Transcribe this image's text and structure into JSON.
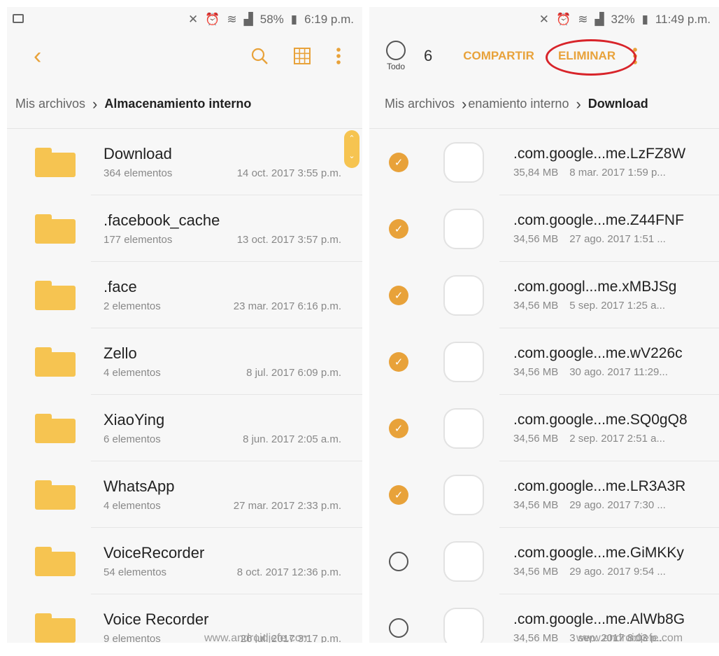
{
  "left": {
    "status": {
      "battery": "58%",
      "time": "6:19 p.m."
    },
    "breadcrumb": {
      "root": "Mis archivos",
      "current": "Almacenamiento interno"
    },
    "folders": [
      {
        "name": "Download",
        "count": "364 elementos",
        "date": "14 oct. 2017 3:55 p.m."
      },
      {
        "name": ".facebook_cache",
        "count": "177 elementos",
        "date": "13 oct. 2017 3:57 p.m."
      },
      {
        "name": ".face",
        "count": "2 elementos",
        "date": "23 mar. 2017 6:16 p.m."
      },
      {
        "name": "Zello",
        "count": "4 elementos",
        "date": "8 jul. 2017 6:09 p.m."
      },
      {
        "name": "XiaoYing",
        "count": "6 elementos",
        "date": "8 jun. 2017 2:05 a.m."
      },
      {
        "name": "WhatsApp",
        "count": "4 elementos",
        "date": "27 mar. 2017 2:33 p.m."
      },
      {
        "name": "VoiceRecorder",
        "count": "54 elementos",
        "date": "8 oct. 2017 12:36 p.m."
      },
      {
        "name": "Voice Recorder",
        "count": "9 elementos",
        "date": "26 jul. 2017 3:17 p.m."
      }
    ],
    "watermark": "www.androidjefe.com"
  },
  "right": {
    "status": {
      "battery": "32%",
      "time": "11:49 p.m."
    },
    "select_all_label": "Todo",
    "selected_count": "6",
    "share_label": "COMPARTIR",
    "delete_label": "ELIMINAR",
    "breadcrumb": {
      "root": "Mis archivos",
      "middle": "enamiento interno",
      "current": "Download"
    },
    "files": [
      {
        "name": ".com.google...me.LzFZ8W",
        "size": "35,84 MB",
        "date": "8 mar. 2017 1:59 p...",
        "checked": true
      },
      {
        "name": ".com.google...me.Z44FNF",
        "size": "34,56 MB",
        "date": "27 ago. 2017 1:51 ...",
        "checked": true
      },
      {
        "name": ".com.googl...me.xMBJSg",
        "size": "34,56 MB",
        "date": "5 sep. 2017 1:25 a...",
        "checked": true
      },
      {
        "name": ".com.google...me.wV226c",
        "size": "34,56 MB",
        "date": "30 ago. 2017 11:29...",
        "checked": true
      },
      {
        "name": ".com.google...me.SQ0gQ8",
        "size": "34,56 MB",
        "date": "2 sep. 2017 2:51 a...",
        "checked": true
      },
      {
        "name": ".com.google...me.LR3A3R",
        "size": "34,56 MB",
        "date": "29 ago. 2017 7:30 ...",
        "checked": true
      },
      {
        "name": ".com.google...me.GiMKKy",
        "size": "34,56 MB",
        "date": "29 ago. 2017 9:54 ...",
        "checked": false
      },
      {
        "name": ".com.google...me.AlWb8G",
        "size": "34,56 MB",
        "date": "3 sep. 2017 8:03 p...",
        "checked": false
      }
    ],
    "watermark": "www.androidjefe.com"
  },
  "icons": {
    "back": "chevron-left-icon",
    "search": "search-icon",
    "grid": "grid-view-icon",
    "more": "more-vertical-icon",
    "check": "checkmark-icon"
  },
  "colors": {
    "accent": "#e8a23a",
    "folder": "#f6c451",
    "highlight": "#d8242a"
  }
}
